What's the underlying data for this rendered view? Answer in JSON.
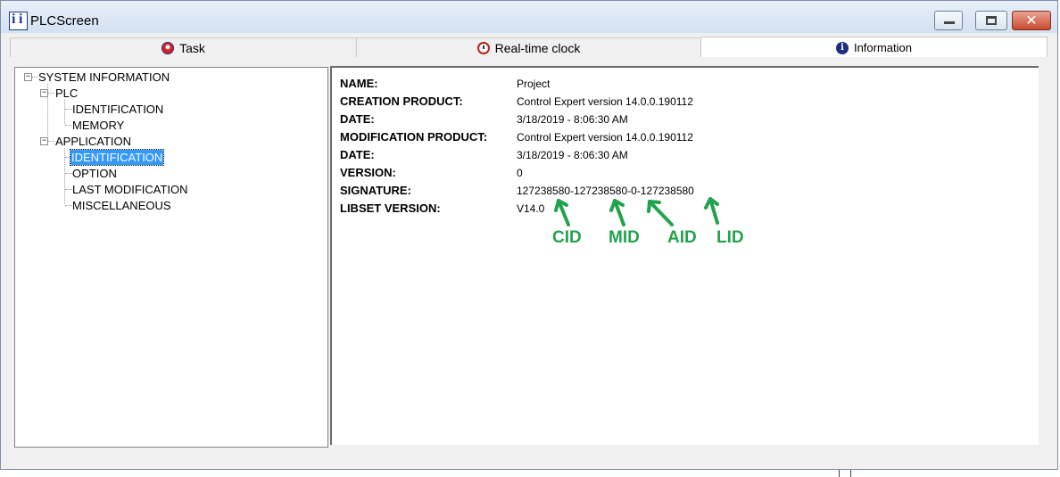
{
  "window": {
    "title": "PLCScreen"
  },
  "tabs": [
    {
      "label": "Task",
      "icon": "task-icon"
    },
    {
      "label": "Real-time clock",
      "icon": "clock-icon"
    },
    {
      "label": "Information",
      "icon": "info-icon"
    }
  ],
  "tree": {
    "root": "SYSTEM INFORMATION",
    "plc": "PLC",
    "plc_children": [
      "IDENTIFICATION",
      "MEMORY"
    ],
    "application": "APPLICATION",
    "application_children": [
      "IDENTIFICATION",
      "OPTION",
      "LAST MODIFICATION",
      "MISCELLANEOUS"
    ],
    "selected": "APPLICATION > IDENTIFICATION"
  },
  "info": {
    "rows": [
      {
        "label": "NAME:",
        "value": "Project"
      },
      {
        "label": "CREATION PRODUCT:",
        "value": "Control Expert version 14.0.0.190112"
      },
      {
        "label": "DATE:",
        "value": "3/18/2019 - 8:06:30 AM"
      },
      {
        "label": "MODIFICATION PRODUCT:",
        "value": "Control Expert version 14.0.0.190112"
      },
      {
        "label": "DATE:",
        "value": "3/18/2019 - 8:06:30 AM"
      },
      {
        "label": "VERSION:",
        "value": "0"
      },
      {
        "label": "SIGNATURE:",
        "value": "127238580-127238580-0-127238580"
      },
      {
        "label": "LIBSET VERSION:",
        "value": "V14.0"
      }
    ]
  },
  "annotations": {
    "labels": [
      "CID",
      "MID",
      "AID",
      "LID"
    ],
    "color": "#22a34c"
  },
  "colors": {
    "selection": "#3399ff",
    "close_button": "#c74a2e",
    "title_gradient": "#d3e1f1"
  }
}
